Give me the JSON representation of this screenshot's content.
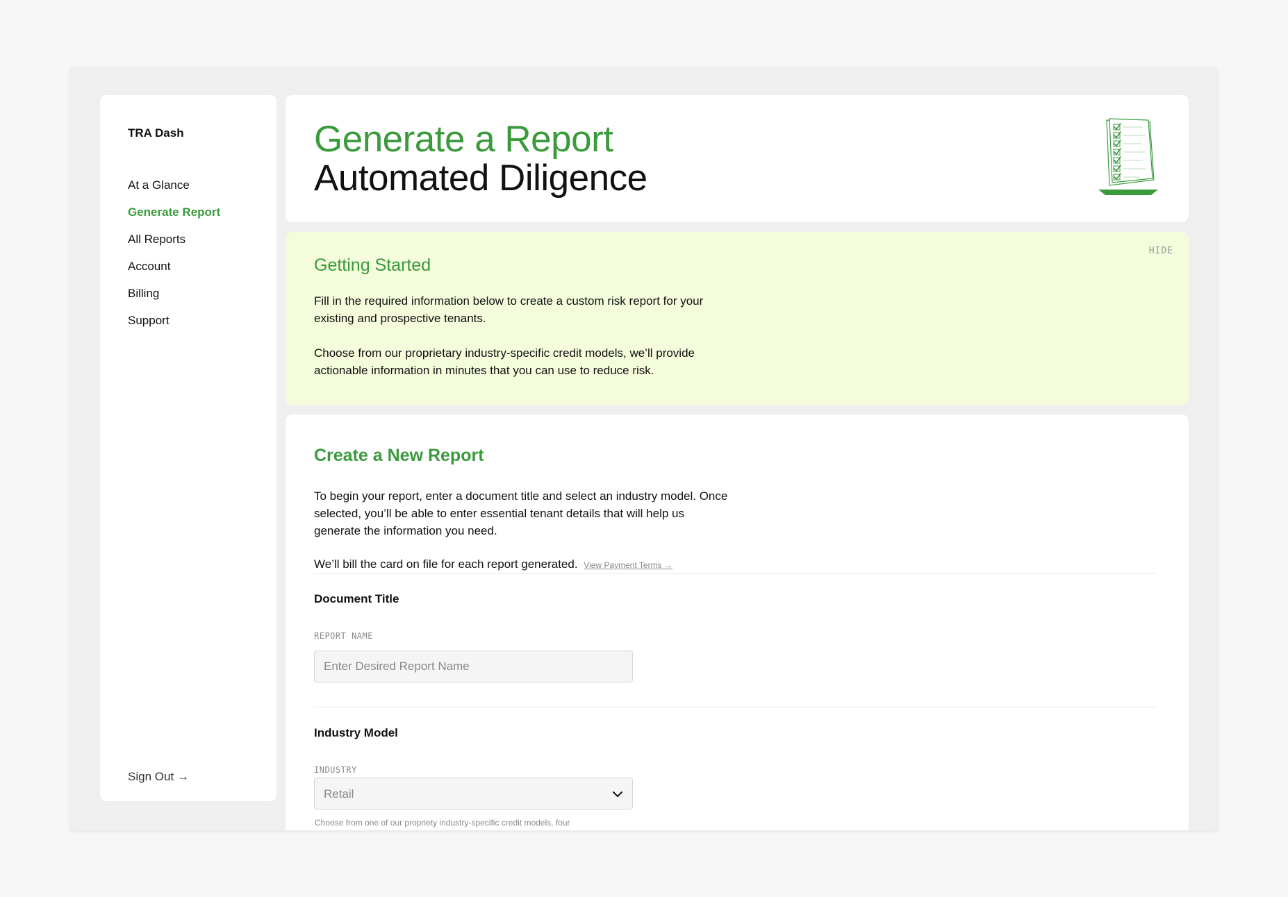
{
  "sidebar": {
    "brand": "TRA Dash",
    "items": [
      {
        "label": "At a Glance",
        "active": false
      },
      {
        "label": "Generate Report",
        "active": true
      },
      {
        "label": "All Reports",
        "active": false
      },
      {
        "label": "Account",
        "active": false
      },
      {
        "label": "Billing",
        "active": false
      },
      {
        "label": "Support",
        "active": false
      }
    ],
    "sign_out": "Sign Out →"
  },
  "header": {
    "title_line1": "Generate a Report",
    "title_line2": "Automated Diligence",
    "illustration_icon": "checklist-document-icon"
  },
  "getting_started": {
    "title": "Getting Started",
    "hide_label": "HIDE",
    "paragraph1": "Fill in the required information below to create a custom risk report for your existing and prospective tenants.",
    "paragraph2": "Choose from our proprietary industry-specific credit models, we’ll provide actionable information in minutes that you can use to reduce risk."
  },
  "create_report": {
    "title": "Create a New Report",
    "intro": "To begin your report, enter a document title and select an industry model. Once selected, you’ll be able to enter essential tenant details that will help us generate the information you need.",
    "billing_note": "We’ll bill the card on file for each report generated.",
    "payment_terms_link": "View Payment Terms →",
    "document_title": {
      "section_label": "Document Title",
      "field_label": "REPORT NAME",
      "placeholder": "Enter Desired Report Name",
      "value": ""
    },
    "industry_model": {
      "section_label": "Industry Model",
      "field_label": "INDUSTRY",
      "selected": "Retail",
      "help_text": "Choose from one of our propriety industry-specific credit models, four"
    }
  },
  "colors": {
    "accent_green": "#3a9a3c",
    "banner_bg": "#f4fcdc",
    "page_bg": "#f7f7f7",
    "window_bg": "#efefef"
  }
}
